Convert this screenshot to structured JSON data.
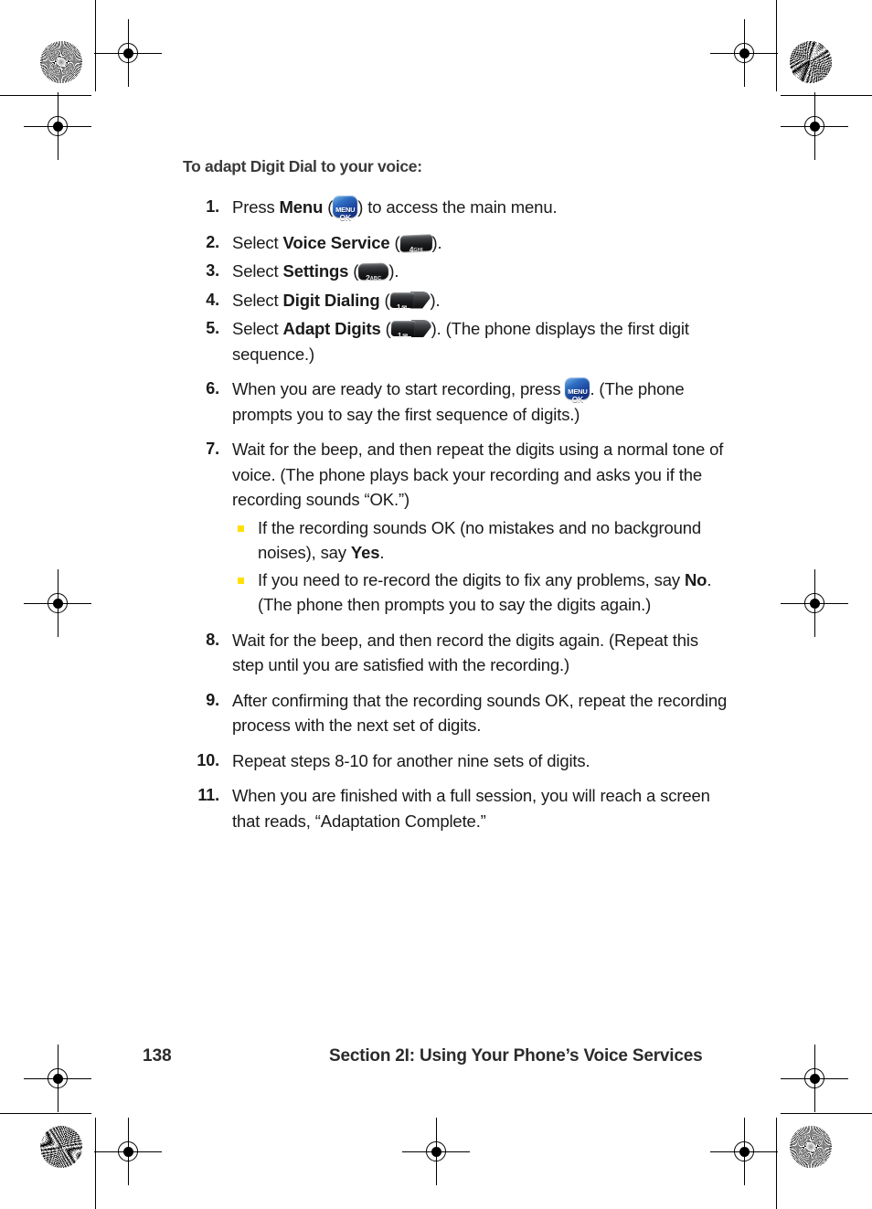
{
  "page": {
    "heading": "To adapt Digit Dial to your voice:",
    "footer": {
      "page_number": "138",
      "section_title": "Section 2I: Using Your Phone’s Voice Services"
    }
  },
  "icons": {
    "menu_ok": {
      "top": "MENU",
      "bottom": "OK"
    },
    "key_4": {
      "digit": "4",
      "letters": "GHI"
    },
    "key_2": {
      "digit": "2",
      "letters": "ABC"
    },
    "key_1": {
      "digit": "1",
      "glyph": "✉"
    }
  },
  "steps": [
    {
      "num": "1.",
      "pre": "Press ",
      "bold": "Menu",
      "mid": " (",
      "icon": "menu-ok",
      "post": ") to access the main menu."
    },
    {
      "num": "2.",
      "pre": "Select ",
      "bold": "Voice Service",
      "mid": " (",
      "icon": "key-4",
      "post": ")."
    },
    {
      "num": "3.",
      "pre": "Select ",
      "bold": "Settings",
      "mid": " (",
      "icon": "key-2",
      "post": ")."
    },
    {
      "num": "4.",
      "pre": "Select ",
      "bold": "Digit Dialing",
      "mid": " (",
      "icon": "key-1",
      "post": ")."
    },
    {
      "num": "5.",
      "pre": "Select ",
      "bold": "Adapt Digits",
      "mid": " (",
      "icon": "key-1",
      "post": "). (The phone displays the first digit sequence.)"
    },
    {
      "num": "6.",
      "pre": "When you are ready to start recording, press ",
      "bold": "",
      "mid": "",
      "icon": "menu-ok",
      "post": ". (The phone prompts you to say the first sequence of digits.)"
    },
    {
      "num": "7.",
      "pre": "Wait for the beep, and then repeat the digits using a normal tone of voice. (The phone plays back your recording and asks you if the recording sounds “OK.”)",
      "bold": "",
      "mid": "",
      "icon": "",
      "post": "",
      "subs": [
        {
          "pre": "If the recording sounds OK (no mistakes and no background noises), say ",
          "bold": "Yes",
          "post": "."
        },
        {
          "pre": "If you need to re-record the digits to fix any problems, say ",
          "bold": "No",
          "post": ". (The phone then prompts you to say the digits again.)"
        }
      ]
    },
    {
      "num": "8.",
      "pre": "Wait for the beep, and then record the digits again. (Repeat this step until you are satisfied with the recording.)",
      "bold": "",
      "mid": "",
      "icon": "",
      "post": ""
    },
    {
      "num": "9.",
      "pre": "After confirming that the recording sounds OK, repeat the recording process with the next set of digits.",
      "bold": "",
      "mid": "",
      "icon": "",
      "post": ""
    },
    {
      "num": "10.",
      "pre": "Repeat steps 8-10 for another nine sets of digits.",
      "bold": "",
      "mid": "",
      "icon": "",
      "post": ""
    },
    {
      "num": "11.",
      "pre": "When you are finished with a full session, you will reach a screen that reads, “Adaptation Complete.”",
      "bold": "",
      "mid": "",
      "icon": "",
      "post": ""
    }
  ],
  "colors": {
    "bullet": "#FFE000",
    "menu_key_blue": "#1a3f96",
    "text": "#1a1a1a",
    "heading": "#3a3a3a"
  }
}
